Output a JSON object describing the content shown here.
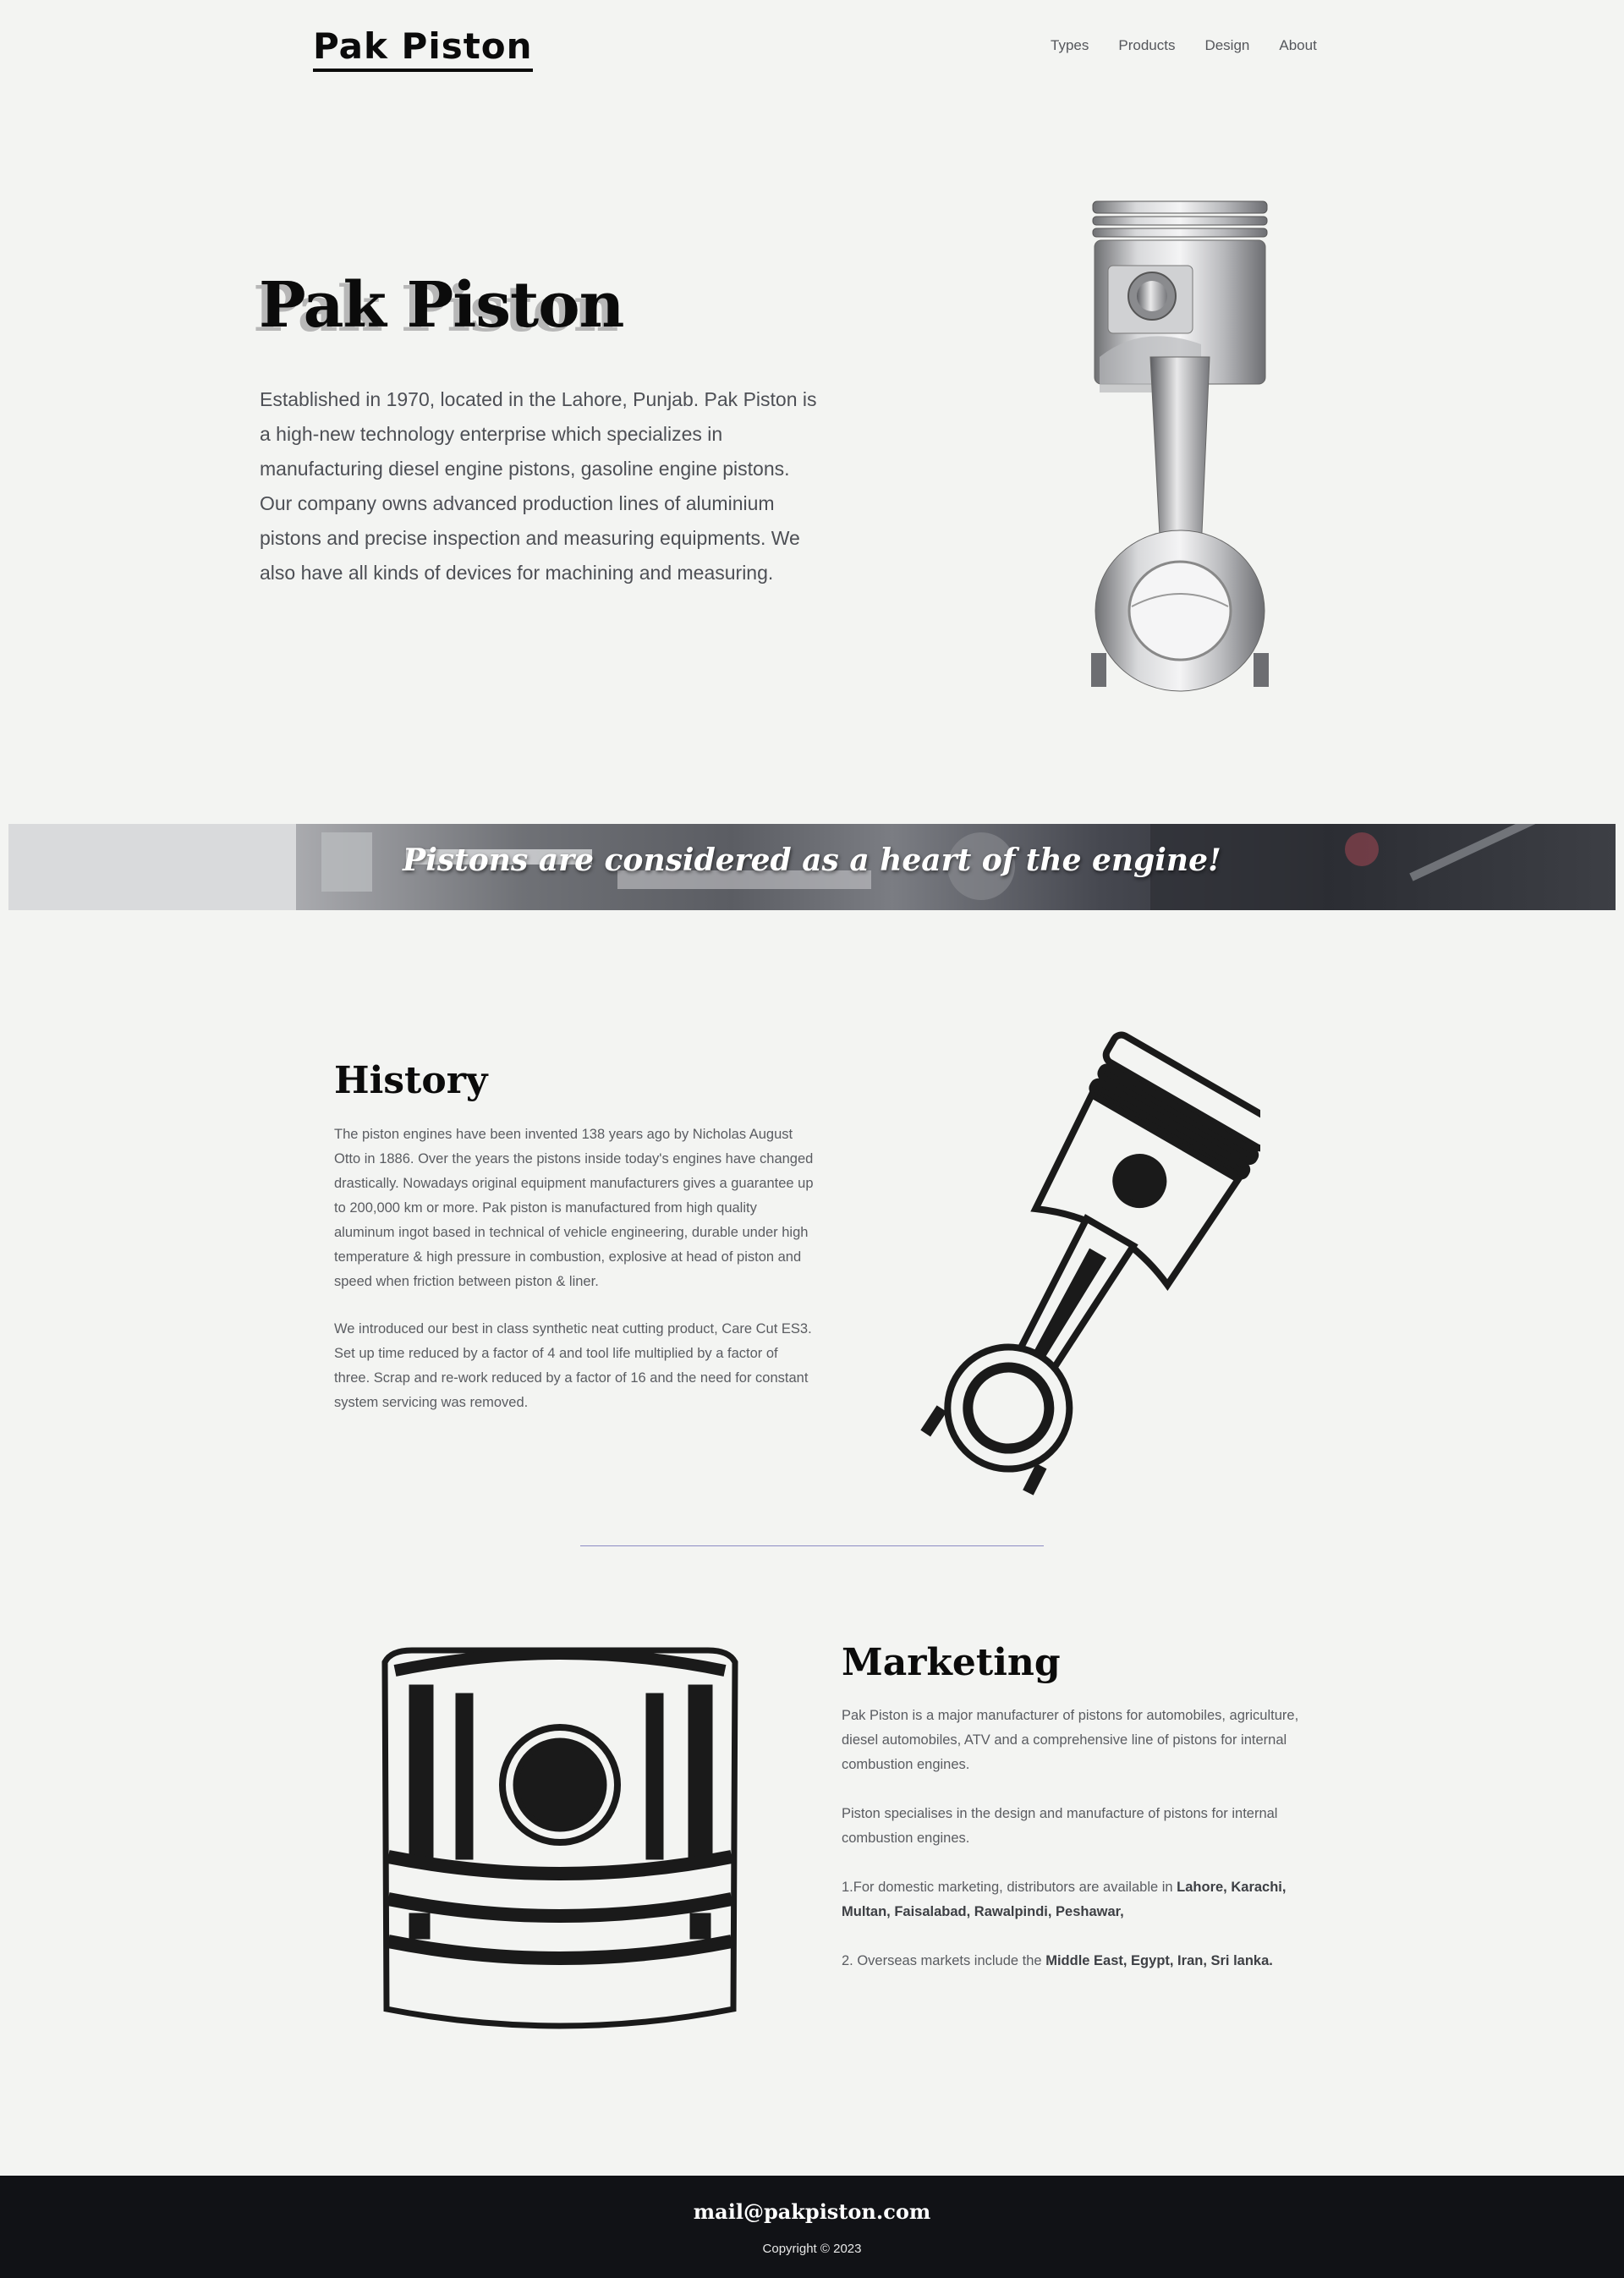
{
  "header": {
    "logo": "Pak Piston",
    "nav": [
      "Types",
      "Products",
      "Design",
      "About"
    ]
  },
  "hero": {
    "title": "Pak Piston",
    "text": "Established in 1970, located in the Lahore, Punjab. Pak Piston is a high-new technology enterprise which specializes in manufacturing diesel engine pistons, gasoline engine pistons. Our company owns advanced production lines of aluminium pistons and precise inspection and measuring equipments. We also have all kinds of devices for machining and measuring.",
    "image_icon": "piston-connecting-rod-photo"
  },
  "banner": {
    "text": "Pistons are considered as a heart of the engine!"
  },
  "history": {
    "title": "History",
    "p1": "The piston engines have been invented 138 years ago by Nicholas August Otto in 1886. Over the years the pistons inside today's engines have changed drastically. Nowadays original equipment manufacturers gives a guarantee up to 200,000 km or more. Pak piston is manufactured from high quality aluminum ingot based in technical of vehicle engineering, durable under high temperature & high pressure in combustion, explosive at head of piston and speed when friction between piston & liner.",
    "p2": "We introduced our best in class synthetic neat cutting product, Care Cut ES3. Set up time reduced by a factor of 4 and tool life multiplied by a factor of three. Scrap and re-work reduced by a factor of 16 and the need for constant system servicing was removed.",
    "image_icon": "piston-illustration"
  },
  "marketing": {
    "title": "Marketing",
    "p1": "Pak Piston is a major manufacturer of pistons for automobiles, agriculture, diesel automobiles, ATV and a comprehensive line of pistons for internal combustion engines.",
    "p2": "Piston specialises in the design and manufacture of pistons for internal combustion engines.",
    "p3_prefix": "1.For domestic marketing, distributors are available in ",
    "p3_bold": "Lahore, Karachi, Multan, Faisalabad, Rawalpindi, Peshawar,",
    "p4_prefix": "2. Overseas markets include the ",
    "p4_bold": "Middle East, Egypt, Iran, Sri lanka.",
    "image_icon": "piston-head-illustration"
  },
  "footer": {
    "mail": "mail@pakpiston.com",
    "copyright": "Copyright © 2023"
  }
}
